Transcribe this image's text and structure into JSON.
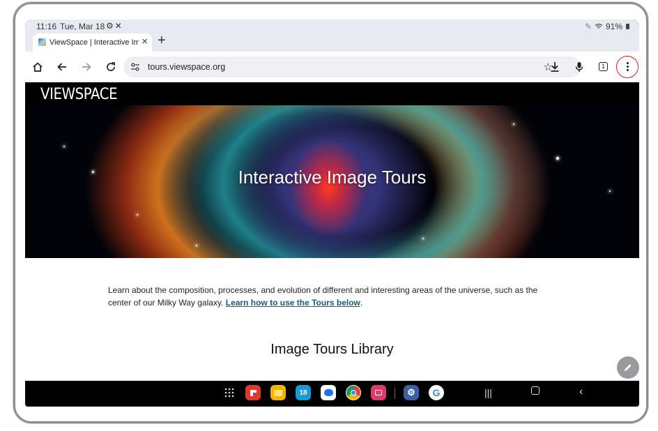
{
  "status_bar": {
    "time": "11:16",
    "date": "Tue, Mar 18",
    "battery": "91%"
  },
  "browser": {
    "tab": {
      "title": "ViewSpace | Interactive Imag"
    },
    "address_bar": {
      "url": "tours.viewspace.org"
    },
    "tab_count": "1"
  },
  "page": {
    "logo": "VIEWSPACE",
    "hero_title": "Interactive Image Tours",
    "intro_text": "Learn about the composition, processes, and evolution of different and interesting areas of the universe, such as the center of our Milky Way galaxy.",
    "intro_link": "Learn how to use the Tours below",
    "intro_suffix": ".",
    "section_title": "Image Tours Library"
  },
  "taskbar": {
    "calendar_day": "18"
  },
  "colors": {
    "accent_ring": "#d81e1e",
    "link": "#1b5b7a",
    "chrome_bg": "#e8eaf1"
  }
}
